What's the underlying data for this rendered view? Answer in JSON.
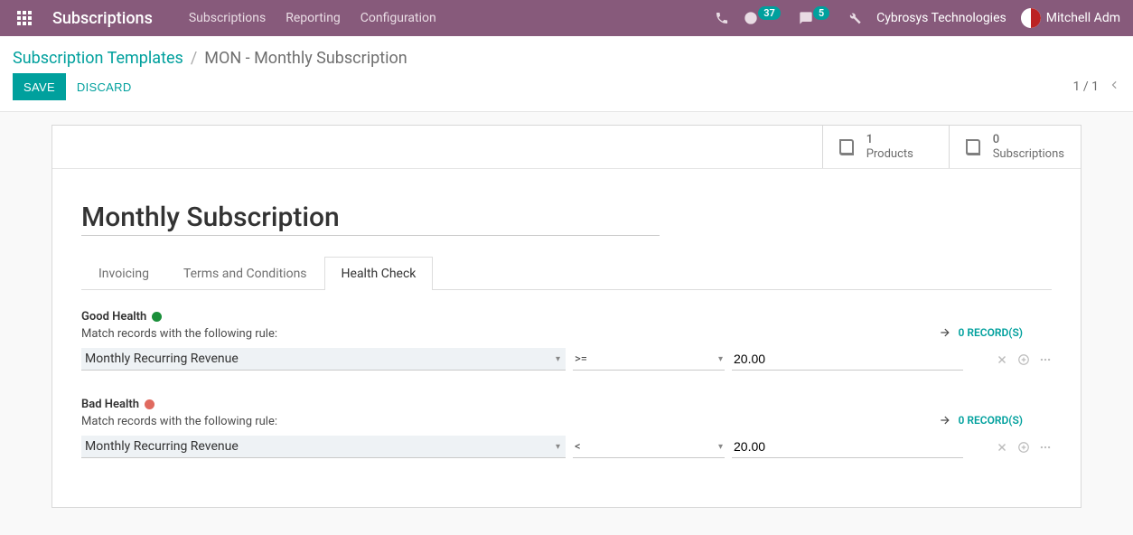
{
  "topnav": {
    "brand": "Subscriptions",
    "menu": [
      "Subscriptions",
      "Reporting",
      "Configuration"
    ],
    "activity_count": "37",
    "message_count": "5",
    "company": "Cybrosys Technologies",
    "user": "Mitchell Adm"
  },
  "breadcrumb": {
    "root": "Subscription Templates",
    "current": "MON - Monthly Subscription"
  },
  "actions": {
    "save": "SAVE",
    "discard": "DISCARD",
    "pager": "1 / 1"
  },
  "stat_buttons": {
    "products": {
      "count": "1",
      "label": "Products"
    },
    "subscriptions": {
      "count": "0",
      "label": "Subscriptions"
    }
  },
  "record": {
    "title": "Monthly Subscription"
  },
  "tabs": [
    "Invoicing",
    "Terms and Conditions",
    "Health Check"
  ],
  "health": {
    "good": {
      "label": "Good Health",
      "rule_text": "Match records with the following rule:",
      "records_link": "0 RECORD(S)",
      "field": "Monthly Recurring Revenue",
      "operator": ">=",
      "value": "20.00"
    },
    "bad": {
      "label": "Bad Health",
      "rule_text": "Match records with the following rule:",
      "records_link": "0 RECORD(S)",
      "field": "Monthly Recurring Revenue",
      "operator": "<",
      "value": "20.00"
    }
  }
}
